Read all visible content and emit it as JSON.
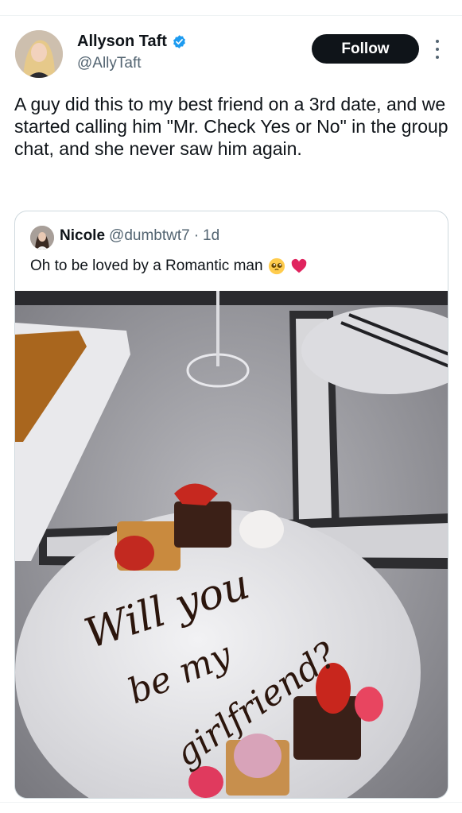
{
  "author": {
    "display_name": "Allyson Taft",
    "handle": "@AllyTaft",
    "verified": true,
    "avatar_icon": "profile-photo"
  },
  "actions": {
    "follow_label": "Follow",
    "more_icon": "more-vertical-icon"
  },
  "tweet": {
    "text": "A guy did this to my best friend on a 3rd date, and we started calling him \"Mr. Check Yes or No\" in the group chat, and she never saw him again."
  },
  "quoted": {
    "display_name": "Nicole",
    "handle": "@dumbtwt7",
    "separator": "·",
    "time": "1d",
    "text": "Oh to be loved by a Romantic man",
    "emojis": [
      "pleading-face-emoji",
      "red-heart-emoji"
    ],
    "photo": {
      "plate_writing": [
        "Will you",
        "be my",
        "girlfriend?"
      ]
    }
  },
  "colors": {
    "accent_blue": "#1d9bf0",
    "text_primary": "#0f1419",
    "text_secondary": "#536471",
    "border": "#cfd9de"
  }
}
